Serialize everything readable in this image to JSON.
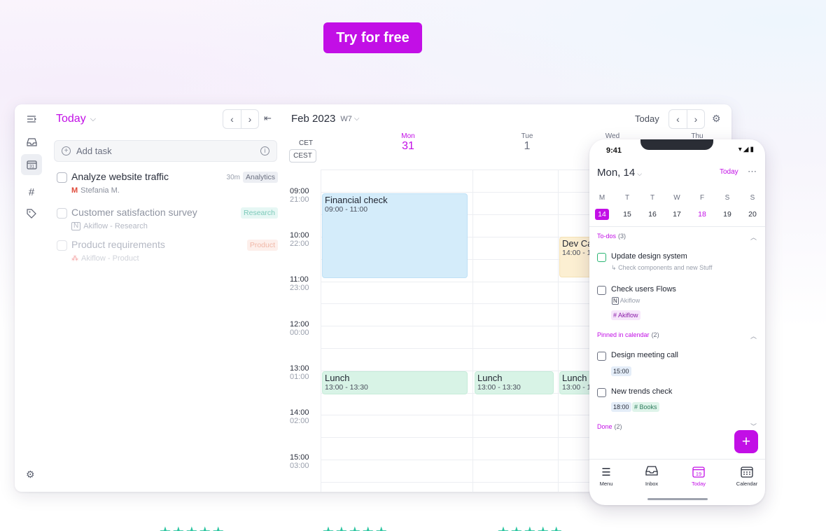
{
  "cta": {
    "label": "Try for free"
  },
  "colors": {
    "brand": "#c20fe6",
    "event_blue": "#d4ecfa",
    "event_yellow": "#fcefd2",
    "event_green": "#d8f3e6",
    "stars": "#2cc5a0"
  },
  "rail": {
    "icons": [
      "sidebar-toggle-icon",
      "inbox-icon",
      "calendar-icon",
      "hash-icon",
      "tag-icon",
      "settings-icon"
    ]
  },
  "tasks_panel": {
    "title": "Today",
    "add_task": "Add task",
    "items": [
      {
        "title": "Analyze website traffic",
        "duration": "30m",
        "tag": "Analytics",
        "meta": "Stefania M.",
        "meta_icon": "gmail-icon"
      },
      {
        "title": "Customer satisfaction survey",
        "tag": "Research",
        "meta": "Akiflow - Research",
        "meta_icon": "notion-icon"
      },
      {
        "title": "Product requirements",
        "tag": "Product",
        "meta": "Akiflow - Product",
        "meta_icon": "asana-icon"
      }
    ]
  },
  "calendar": {
    "title": "Feb 2023",
    "week": "W7",
    "today_label": "Today",
    "tz_primary": "CET",
    "tz_secondary": "CEST",
    "days": [
      {
        "name": "Mon",
        "date": "31"
      },
      {
        "name": "Tue",
        "date": "1"
      },
      {
        "name": "Wed",
        "date": ""
      },
      {
        "name": "Thu",
        "date": ""
      }
    ],
    "times": [
      {
        "t1": "09:00",
        "t2": "21:00"
      },
      {
        "t1": "10:00",
        "t2": "22:00"
      },
      {
        "t1": "11:00",
        "t2": "23:00"
      },
      {
        "t1": "12:00",
        "t2": "00:00"
      },
      {
        "t1": "13:00",
        "t2": "01:00"
      },
      {
        "t1": "14:00",
        "t2": "02:00"
      },
      {
        "t1": "15:00",
        "t2": "03:00"
      }
    ],
    "events": [
      {
        "name": "Financial check",
        "time": "09:00 - 11:00"
      },
      {
        "name": "Dev Ca",
        "time": "14:00 - 1"
      },
      {
        "name": "Lunch",
        "time": "13:00 - 13:30"
      },
      {
        "name": "Lunch",
        "time": "13:00 - 13:30"
      },
      {
        "name": "Lunch",
        "time": "13:00 - 1"
      }
    ]
  },
  "phone": {
    "status_time": "9:41",
    "date_title": "Mon, 14",
    "today_label": "Today",
    "weekdays": [
      "M",
      "T",
      "T",
      "W",
      "F",
      "S",
      "S"
    ],
    "week_dates": [
      "14",
      "15",
      "16",
      "17",
      "18",
      "19",
      "20"
    ],
    "todos_label": "To-dos",
    "todos_count": "(3)",
    "todos": [
      {
        "title": "Update design system",
        "sub": "Check components and new Stuff"
      },
      {
        "title": "Check users Flows",
        "sub": "Akiflow",
        "chip": "# Akiflow"
      }
    ],
    "pinned_label": "Pinned in calendar",
    "pinned_count": "(2)",
    "pinned": [
      {
        "title": "Design meeting call",
        "time": "15:00"
      },
      {
        "title": "New trends check",
        "time": "18:00",
        "chip": "# Books"
      }
    ],
    "done_label": "Done",
    "done_count": "(2)",
    "tabs": [
      {
        "label": "Menu",
        "icon": "menu-icon"
      },
      {
        "label": "Inbox",
        "icon": "inbox-icon"
      },
      {
        "label": "Today",
        "icon": "calendar-today-icon",
        "badge": "19"
      },
      {
        "label": "Calendar",
        "icon": "calendar-icon"
      }
    ]
  },
  "ratings": [
    "★★★★★",
    "★★★★★",
    "★★★★★"
  ]
}
